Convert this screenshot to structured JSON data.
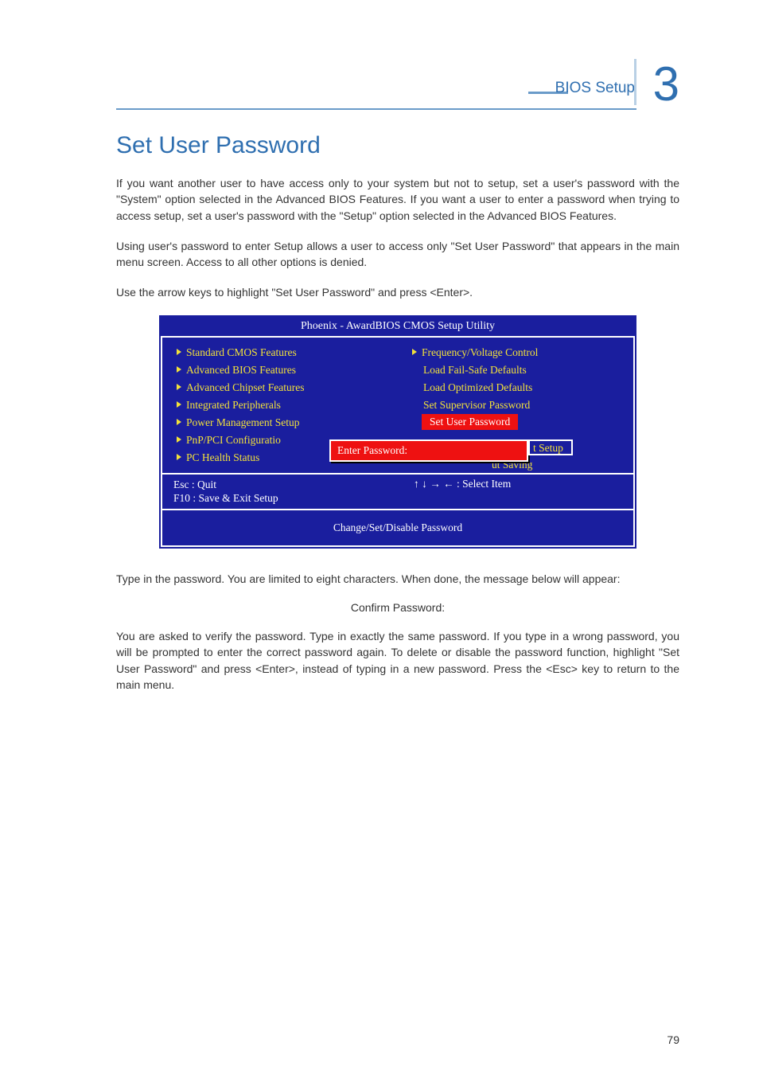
{
  "header": {
    "section_label": "BIOS Setup",
    "chapter_number": "3"
  },
  "title": "Set User Password",
  "paragraphs": {
    "p1": "If you want another user to have access only to your system but not to setup, set a user's password with the \"System\" option selected in the Advanced BIOS Features. If you want a user to enter a password when trying to access setup, set a user's password with the \"Setup\" option selected in the Advanced BIOS Features.",
    "p2": "Using user's password to enter Setup allows a user to access only \"Set User Password\" that appears in the main menu screen. Access to all other options is denied.",
    "p3": "Use the arrow keys to highlight \"Set User Password\" and press <Enter>.",
    "p4": "Type in the password. You are limited to eight characters. When done, the message below will appear:",
    "confirm": "Confirm Password:",
    "p5": "You are asked to verify the password. Type in exactly the same password. If you type in a wrong password, you will be prompted to enter the correct password again. To delete or disable the password function, highlight \"Set User Password\" and press <Enter>, instead of typing in a new password. Press the <Esc> key to return to the main menu."
  },
  "bios": {
    "title": "Phoenix - AwardBIOS CMOS Setup Utility",
    "left_items": [
      "Standard CMOS Features",
      "Advanced BIOS Features",
      "Advanced Chipset Features",
      "Integrated Peripherals",
      "Power Management Setup",
      "PnP/PCI Configuratio",
      "PC Health Status"
    ],
    "right_items": [
      "Frequency/Voltage Control",
      "Load Fail-Safe Defaults",
      "Load Optimized Defaults",
      "Set Supervisor Password"
    ],
    "highlighted": "Set User Password",
    "partial_save": "t Setup",
    "exit_fragment": "ut Saving",
    "dialog": "Enter Password:",
    "footer": {
      "esc": "Esc   :  Quit",
      "f10": "F10   :  Save & Exit Setup",
      "nav": "↑ ↓ → ← : Select Item",
      "help": "Change/Set/Disable Password"
    }
  },
  "page_number": "79"
}
